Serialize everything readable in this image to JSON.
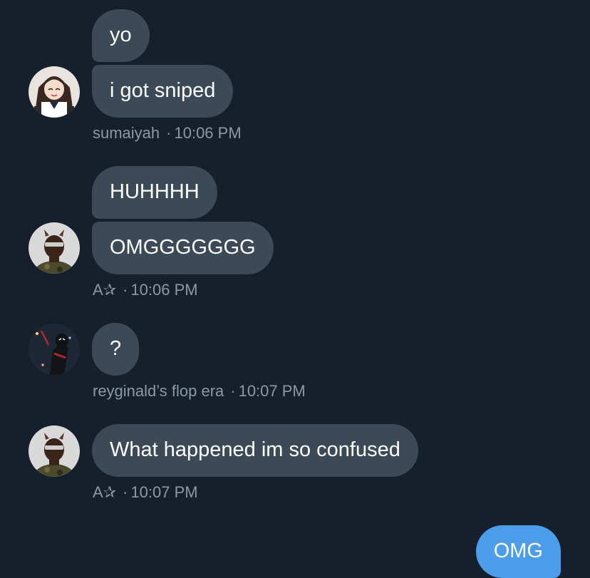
{
  "messages": [
    {
      "sender": "sumaiyah",
      "time": "10:06 PM",
      "lines": [
        "yo",
        "i got sniped"
      ],
      "avatar": "anime-girl-avatar-icon"
    },
    {
      "sender": "A✰",
      "time": "10:06 PM",
      "lines": [
        "HUHHHH",
        "OMGGGGGGG"
      ],
      "avatar": "masked-person-avatar-icon"
    },
    {
      "sender": "reyginald’s flop era",
      "time": "10:07 PM",
      "lines": [
        "?"
      ],
      "avatar": "spider-hero-avatar-icon"
    },
    {
      "sender": "A✰",
      "time": "10:07 PM",
      "lines": [
        "What happened im so confused"
      ],
      "avatar": "masked-person-avatar-icon"
    }
  ],
  "sent": {
    "text": "OMG"
  },
  "separator": "·",
  "colors": {
    "background": "#16202c",
    "received_bubble": "#3c4a58",
    "sent_bubble": "#4c9eea",
    "meta_text": "#8b98a5"
  }
}
